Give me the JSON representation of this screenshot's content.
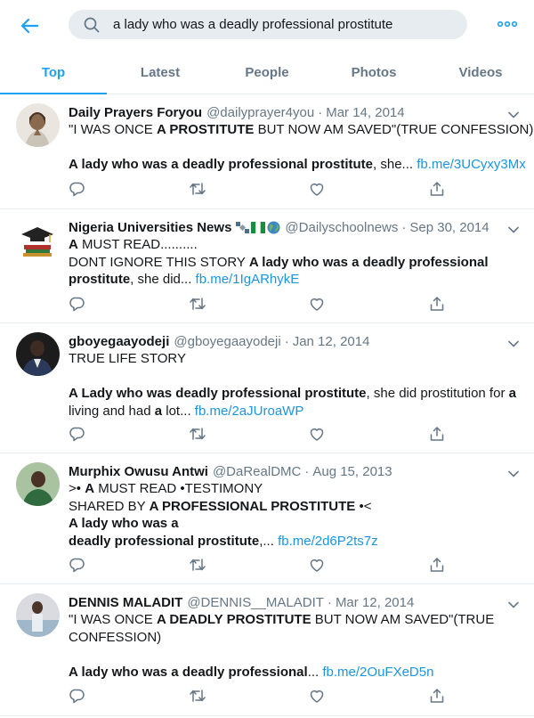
{
  "header": {
    "search_value": "a lady who was a deadly professional prostitute",
    "back_icon": "arrow-left-icon",
    "more_icon": "more-horizontal-icon",
    "accent": "#1da1f2"
  },
  "tabs": [
    {
      "label": "Top",
      "active": true
    },
    {
      "label": "Latest"
    },
    {
      "label": "People"
    },
    {
      "label": "Photos"
    },
    {
      "label": "Videos"
    }
  ],
  "tweets": [
    {
      "name": "Daily Prayers Foryou",
      "handle": "@dailyprayer4you",
      "date": "Mar 14, 2014",
      "l1_pre": "\"I WAS ONCE ",
      "l1_bold": "A PROSTITUTE",
      "l1_post": " BUT NOW AM SAVED\"(TRUE CONFESSION)",
      "l2_bold": "A lady who was a deadly professional prostitute",
      "l2_post": ", she... ",
      "link": "fb.me/3UCyxy3Mx"
    },
    {
      "name": "Nigeria Universities News",
      "handle": "@Dailyschoolnews",
      "date": "Sep 30, 2014",
      "l1_bold": "A",
      "l1_post": " MUST READ..........",
      "l2_pre": "DONT IGNORE THIS STORY ",
      "l2_bold": "A lady who was a deadly professional",
      "l3_bold": "prostitute",
      "l3_post": ", she did... ",
      "link": "fb.me/1IgARhykE"
    },
    {
      "name": "gboyegaayodeji",
      "handle": "@gboyegaayodeji",
      "date": "Jan 12, 2014",
      "l1": "TRUE LIFE STORY",
      "l2_bold": "A Lady who was deadly professional prostitute",
      "l2_mid": ", she did prostitution for ",
      "l2_bold2": "a",
      "l3_pre": " living and had ",
      "l3_bold": "a",
      "l3_post": " lot... ",
      "link": "fb.me/2aJUroaWP"
    },
    {
      "name": "Murphix Owusu Antwi",
      "handle": "@DaRealDMC",
      "date": "Aug 15, 2013",
      "l1_pre": ">• ",
      "l1_bold": "A",
      "l1_post": " MUST READ •TESTIMONY",
      "l2_pre": "SHARED BY ",
      "l2_bold": "A PROFESSIONAL PROSTITUTE",
      "l2_post": " •<",
      "l3_bold": "A lady who was a",
      "l4_bold": "deadly professional prostitute",
      "l4_post": ",... ",
      "link": "fb.me/2d6P2ts7z"
    },
    {
      "name": "DENNIS MALADIT",
      "handle": "@DENNIS__MALADIT",
      "date": "Mar 12, 2014",
      "l1_pre": "\"I WAS ONCE ",
      "l1_bold": "A DEADLY PROSTITUTE",
      "l1_post": " BUT NOW AM SAVED\"(TRUE",
      "l2": "CONFESSION)",
      "l3_bold": "A lady who was a deadly professional",
      "l3_post": "... ",
      "link": "fb.me/2OuFXeD5n"
    }
  ],
  "icons": {
    "reply": "reply-icon",
    "retweet": "retweet-icon",
    "like": "heart-icon",
    "share": "share-icon",
    "caret": "chevron-down-icon"
  }
}
